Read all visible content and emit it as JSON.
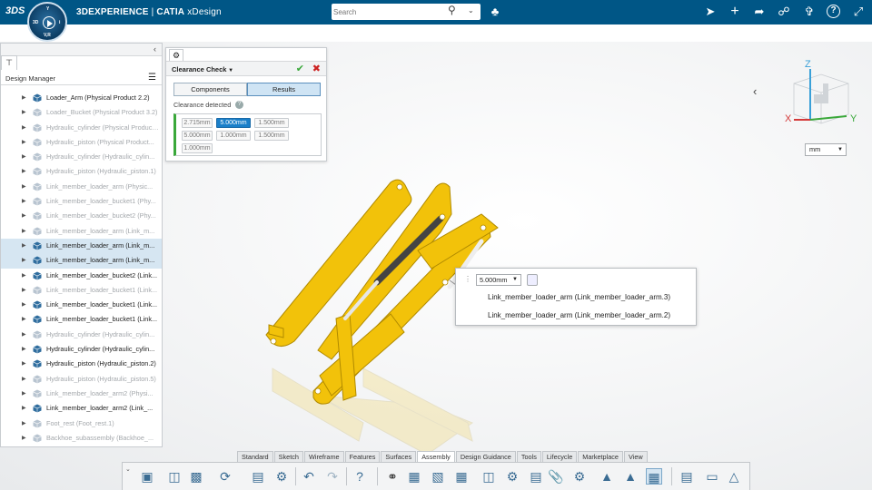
{
  "topbar": {
    "logo": "3DS",
    "brand_bold": "3DEXPERIENCE",
    "brand_sep": " | ",
    "brand_app": "CATIA",
    "brand_product": " xDesign",
    "search_placeholder": "Search",
    "icons": [
      "search-icon",
      "chevron-down-icon",
      "tag-icon",
      "share-link-icon",
      "plus-icon",
      "forward-icon",
      "network-share-icon",
      "tools-icon",
      "help-icon",
      "collapse-arrows-icon"
    ]
  },
  "compass": {
    "n": "Y",
    "s": "V,R",
    "w": "3D",
    "e": "i"
  },
  "design_manager": {
    "title": "Design Manager",
    "items": [
      {
        "label": "Loader_Arm (Physical Product 2.2)",
        "dim": false,
        "sel": false
      },
      {
        "label": "Loader_Bucket (Physical Product 3.2)",
        "dim": true,
        "sel": false
      },
      {
        "label": "Hydraulic_cylinder (Physical Product...",
        "dim": true,
        "sel": false
      },
      {
        "label": "Hydraulic_piston (Physical Product...",
        "dim": true,
        "sel": false
      },
      {
        "label": "Hydraulic_cylinder (Hydraulic_cylin...",
        "dim": true,
        "sel": false
      },
      {
        "label": "Hydraulic_piston (Hydraulic_piston.1)",
        "dim": true,
        "sel": false
      },
      {
        "label": "Link_member_loader_arm (Physic...",
        "dim": true,
        "sel": false
      },
      {
        "label": "Link_member_loader_bucket1 (Phy...",
        "dim": true,
        "sel": false
      },
      {
        "label": "Link_member_loader_bucket2 (Phy...",
        "dim": true,
        "sel": false
      },
      {
        "label": "Link_member_loader_arm (Link_m...",
        "dim": true,
        "sel": false
      },
      {
        "label": "Link_member_loader_arm (Link_m...",
        "dim": false,
        "sel": true
      },
      {
        "label": "Link_member_loader_arm (Link_m...",
        "dim": false,
        "sel": true
      },
      {
        "label": "Link_member_loader_bucket2 (Link...",
        "dim": false,
        "sel": false
      },
      {
        "label": "Link_member_loader_bucket1 (Link...",
        "dim": true,
        "sel": false
      },
      {
        "label": "Link_member_loader_bucket1 (Link...",
        "dim": false,
        "sel": false
      },
      {
        "label": "Link_member_loader_bucket1 (Link...",
        "dim": false,
        "sel": false
      },
      {
        "label": "Hydraulic_cylinder (Hydraulic_cylin...",
        "dim": true,
        "sel": false
      },
      {
        "label": "Hydraulic_cylinder (Hydraulic_cylin...",
        "dim": false,
        "sel": false
      },
      {
        "label": "Hydraulic_piston (Hydraulic_piston.2)",
        "dim": false,
        "sel": false
      },
      {
        "label": "Hydraulic_piston (Hydraulic_piston.5)",
        "dim": true,
        "sel": false
      },
      {
        "label": "Link_member_loader_arm2 (Physi...",
        "dim": true,
        "sel": false
      },
      {
        "label": "Link_member_loader_arm2 (Link_...",
        "dim": false,
        "sel": false
      },
      {
        "label": "Foot_rest (Foot_rest.1)",
        "dim": true,
        "sel": false
      },
      {
        "label": "Backhoe_subassembly (Backhoe_...",
        "dim": true,
        "sel": false
      }
    ]
  },
  "clearance": {
    "title": "Clearance Check",
    "tab_components": "Components",
    "tab_results": "Results",
    "detected": "Clearance detected",
    "values": [
      "2.715mm",
      "5.000mm",
      "1.500mm",
      "5.000mm",
      "1.000mm",
      "1.500mm",
      "1.000mm"
    ],
    "active_index": 1
  },
  "popup": {
    "value": "5.000mm",
    "line1": "Link_member_loader_arm (Link_member_loader_arm.3)",
    "line2": "Link_member_loader_arm (Link_member_loader_arm.2)"
  },
  "navcube": {
    "z": "Z",
    "x": "X",
    "y": "Y"
  },
  "unit": "mm",
  "tabs": [
    "Standard",
    "Sketch",
    "Wireframe",
    "Features",
    "Surfaces",
    "Assembly",
    "Design Guidance",
    "Tools",
    "Lifecycle",
    "Marketplace",
    "View"
  ],
  "active_tab": "Assembly",
  "colors": {
    "topbar": "#005686",
    "model_yellow": "#f2c20a",
    "accent": "#1a7fc9",
    "ok": "#3aa83a"
  }
}
